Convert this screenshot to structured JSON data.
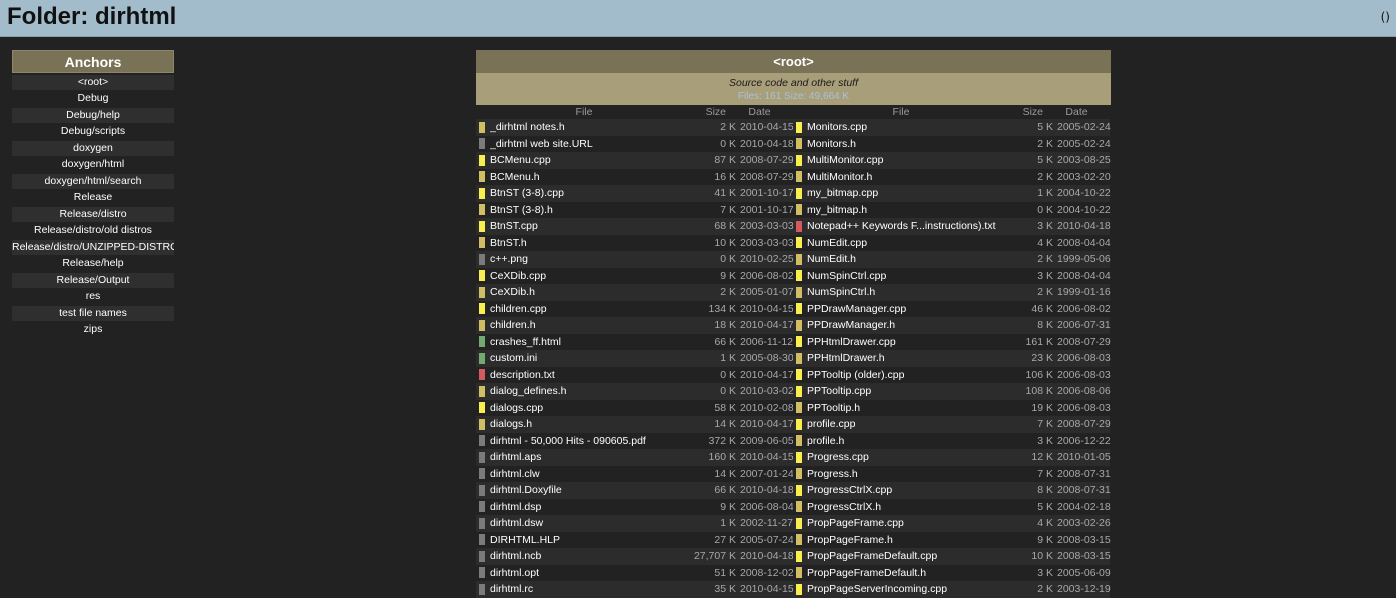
{
  "header": {
    "title": "Folder: dirhtml",
    "corner": "()"
  },
  "anchors": {
    "title": "Anchors",
    "items": [
      "<root>",
      "Debug",
      "Debug/help",
      "Debug/scripts",
      "doxygen",
      "doxygen/html",
      "doxygen/html/search",
      "Release",
      "Release/distro",
      "Release/distro/old distros",
      "Release/distro/UNZIPPED-DISTRO",
      "Release/help",
      "Release/Output",
      "res",
      "test file names",
      "zips"
    ]
  },
  "folder": {
    "name": "<root>",
    "description": "Source code and other stuff",
    "stats": "Files: 161    Size: 49,664 K"
  },
  "columns": {
    "file": "File",
    "size": "Size",
    "date": "Date"
  },
  "colors": {
    "yellow": "#f8ee4f",
    "khaki": "#d1bd64",
    "gray": "#7b7b7b",
    "green": "#73a86f",
    "red": "#d45a5f"
  },
  "files_left": [
    {
      "name": "_dirhtml notes.h",
      "size": "2 K",
      "date": "2010-04-15",
      "color": "#d1bd64"
    },
    {
      "name": "_dirhtml web site.URL",
      "size": "0 K",
      "date": "2010-04-18",
      "color": "#7b7b7b"
    },
    {
      "name": "BCMenu.cpp",
      "size": "87 K",
      "date": "2008-07-29",
      "color": "#f8ee4f"
    },
    {
      "name": "BCMenu.h",
      "size": "16 K",
      "date": "2008-07-29",
      "color": "#d1bd64"
    },
    {
      "name": "BtnST (3-8).cpp",
      "size": "41 K",
      "date": "2001-10-17",
      "color": "#f8ee4f"
    },
    {
      "name": "BtnST (3-8).h",
      "size": "7 K",
      "date": "2001-10-17",
      "color": "#d1bd64"
    },
    {
      "name": "BtnST.cpp",
      "size": "68 K",
      "date": "2003-03-03",
      "color": "#f8ee4f"
    },
    {
      "name": "BtnST.h",
      "size": "10 K",
      "date": "2003-03-03",
      "color": "#d1bd64"
    },
    {
      "name": "c++.png",
      "size": "0 K",
      "date": "2010-02-25",
      "color": "#7b7b7b"
    },
    {
      "name": "CeXDib.cpp",
      "size": "9 K",
      "date": "2006-08-02",
      "color": "#f8ee4f"
    },
    {
      "name": "CeXDib.h",
      "size": "2 K",
      "date": "2005-01-07",
      "color": "#d1bd64"
    },
    {
      "name": "children.cpp",
      "size": "134 K",
      "date": "2010-04-15",
      "color": "#f8ee4f"
    },
    {
      "name": "children.h",
      "size": "18 K",
      "date": "2010-04-17",
      "color": "#d1bd64"
    },
    {
      "name": "crashes_ff.html",
      "size": "66 K",
      "date": "2006-11-12",
      "color": "#73a86f"
    },
    {
      "name": "custom.ini",
      "size": "1 K",
      "date": "2005-08-30",
      "color": "#73a86f"
    },
    {
      "name": "description.txt",
      "size": "0 K",
      "date": "2010-04-17",
      "color": "#d45a5f"
    },
    {
      "name": "dialog_defines.h",
      "size": "0 K",
      "date": "2010-03-02",
      "color": "#d1bd64"
    },
    {
      "name": "dialogs.cpp",
      "size": "58 K",
      "date": "2010-02-08",
      "color": "#f8ee4f"
    },
    {
      "name": "dialogs.h",
      "size": "14 K",
      "date": "2010-04-17",
      "color": "#d1bd64"
    },
    {
      "name": "dirhtml - 50,000 Hits - 090605.pdf",
      "size": "372 K",
      "date": "2009-06-05",
      "color": "#7b7b7b"
    },
    {
      "name": "dirhtml.aps",
      "size": "160 K",
      "date": "2010-04-15",
      "color": "#7b7b7b"
    },
    {
      "name": "dirhtml.clw",
      "size": "14 K",
      "date": "2007-01-24",
      "color": "#7b7b7b"
    },
    {
      "name": "dirhtml.Doxyfile",
      "size": "66 K",
      "date": "2010-04-18",
      "color": "#7b7b7b"
    },
    {
      "name": "dirhtml.dsp",
      "size": "9 K",
      "date": "2006-08-04",
      "color": "#7b7b7b"
    },
    {
      "name": "dirhtml.dsw",
      "size": "1 K",
      "date": "2002-11-27",
      "color": "#7b7b7b"
    },
    {
      "name": "DIRHTML.HLP",
      "size": "27 K",
      "date": "2005-07-24",
      "color": "#7b7b7b"
    },
    {
      "name": "dirhtml.ncb",
      "size": "27,707 K",
      "date": "2010-04-18",
      "color": "#7b7b7b"
    },
    {
      "name": "dirhtml.opt",
      "size": "51 K",
      "date": "2008-12-02",
      "color": "#7b7b7b"
    },
    {
      "name": "dirhtml.rc",
      "size": "35 K",
      "date": "2010-04-15",
      "color": "#7b7b7b"
    }
  ],
  "files_right": [
    {
      "name": "Monitors.cpp",
      "size": "5 K",
      "date": "2005-02-24",
      "color": "#f8ee4f"
    },
    {
      "name": "Monitors.h",
      "size": "2 K",
      "date": "2005-02-24",
      "color": "#d1bd64"
    },
    {
      "name": "MultiMonitor.cpp",
      "size": "5 K",
      "date": "2003-08-25",
      "color": "#f8ee4f"
    },
    {
      "name": "MultiMonitor.h",
      "size": "2 K",
      "date": "2003-02-20",
      "color": "#d1bd64"
    },
    {
      "name": "my_bitmap.cpp",
      "size": "1 K",
      "date": "2004-10-22",
      "color": "#f8ee4f"
    },
    {
      "name": "my_bitmap.h",
      "size": "0 K",
      "date": "2004-10-22",
      "color": "#d1bd64"
    },
    {
      "name": "Notepad++ Keywords F...instructions).txt",
      "size": "3 K",
      "date": "2010-04-18",
      "color": "#d45a5f"
    },
    {
      "name": "NumEdit.cpp",
      "size": "4 K",
      "date": "2008-04-04",
      "color": "#f8ee4f"
    },
    {
      "name": "NumEdit.h",
      "size": "2 K",
      "date": "1999-05-06",
      "color": "#d1bd64"
    },
    {
      "name": "NumSpinCtrl.cpp",
      "size": "3 K",
      "date": "2008-04-04",
      "color": "#f8ee4f"
    },
    {
      "name": "NumSpinCtrl.h",
      "size": "2 K",
      "date": "1999-01-16",
      "color": "#d1bd64"
    },
    {
      "name": "PPDrawManager.cpp",
      "size": "46 K",
      "date": "2006-08-02",
      "color": "#f8ee4f"
    },
    {
      "name": "PPDrawManager.h",
      "size": "8 K",
      "date": "2006-07-31",
      "color": "#d1bd64"
    },
    {
      "name": "PPHtmlDrawer.cpp",
      "size": "161 K",
      "date": "2008-07-29",
      "color": "#f8ee4f"
    },
    {
      "name": "PPHtmlDrawer.h",
      "size": "23 K",
      "date": "2006-08-03",
      "color": "#d1bd64"
    },
    {
      "name": "PPTooltip (older).cpp",
      "size": "106 K",
      "date": "2006-08-03",
      "color": "#f8ee4f"
    },
    {
      "name": "PPTooltip.cpp",
      "size": "108 K",
      "date": "2006-08-06",
      "color": "#f8ee4f"
    },
    {
      "name": "PPTooltip.h",
      "size": "19 K",
      "date": "2006-08-03",
      "color": "#d1bd64"
    },
    {
      "name": "profile.cpp",
      "size": "7 K",
      "date": "2008-07-29",
      "color": "#f8ee4f"
    },
    {
      "name": "profile.h",
      "size": "3 K",
      "date": "2006-12-22",
      "color": "#d1bd64"
    },
    {
      "name": "Progress.cpp",
      "size": "12 K",
      "date": "2010-01-05",
      "color": "#f8ee4f"
    },
    {
      "name": "Progress.h",
      "size": "7 K",
      "date": "2008-07-31",
      "color": "#d1bd64"
    },
    {
      "name": "ProgressCtrlX.cpp",
      "size": "8 K",
      "date": "2008-07-31",
      "color": "#f8ee4f"
    },
    {
      "name": "ProgressCtrlX.h",
      "size": "5 K",
      "date": "2004-02-18",
      "color": "#d1bd64"
    },
    {
      "name": "PropPageFrame.cpp",
      "size": "4 K",
      "date": "2003-02-26",
      "color": "#f8ee4f"
    },
    {
      "name": "PropPageFrame.h",
      "size": "9 K",
      "date": "2008-03-15",
      "color": "#d1bd64"
    },
    {
      "name": "PropPageFrameDefault.cpp",
      "size": "10 K",
      "date": "2008-03-15",
      "color": "#f8ee4f"
    },
    {
      "name": "PropPageFrameDefault.h",
      "size": "3 K",
      "date": "2005-06-09",
      "color": "#d1bd64"
    },
    {
      "name": "PropPageServerIncoming.cpp",
      "size": "2 K",
      "date": "2003-12-19",
      "color": "#f8ee4f"
    }
  ]
}
